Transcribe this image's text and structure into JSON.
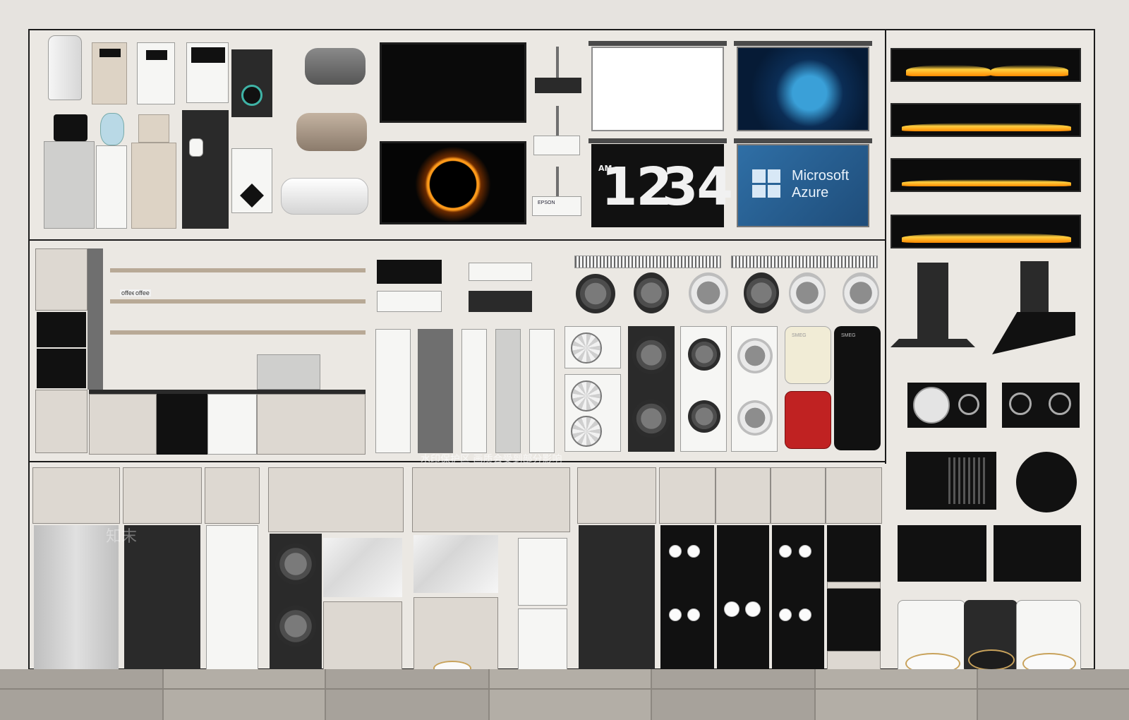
{
  "tv_clock": {
    "ampm": "AM",
    "hours": "12",
    "minutes": "34"
  },
  "tv_brand": {
    "line1": "Microsoft",
    "line2": "Azure"
  },
  "labels": {
    "coffee_1": "offee",
    "coffee_2": "offee",
    "fridge_brand_1": "SMEG",
    "fridge_brand_2": "SMEG",
    "projector_brand": "EPSON",
    "watermark_banner": "水印保护区 画质会受到部分影响",
    "watermark_mark": "知末"
  }
}
